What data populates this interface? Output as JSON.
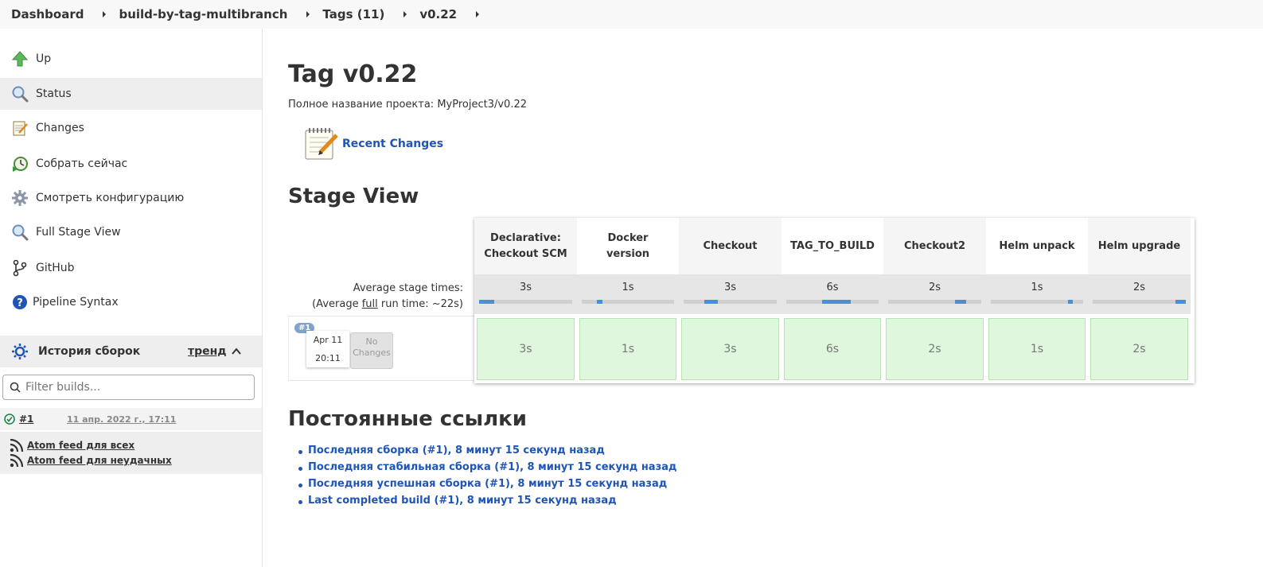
{
  "breadcrumb": [
    "Dashboard",
    "build-by-tag-multibranch",
    "Tags (11)",
    "v0.22"
  ],
  "sidebar": {
    "tasks": [
      {
        "label": "Up",
        "icon": "up-arrow-icon"
      },
      {
        "label": "Status",
        "icon": "magnifier-icon"
      },
      {
        "label": "Changes",
        "icon": "notepad-icon"
      },
      {
        "label": "Собрать сейчас",
        "icon": "build-clock-icon"
      },
      {
        "label": "Смотреть конфигурацию",
        "icon": "gear-icon"
      },
      {
        "label": "Full Stage View",
        "icon": "magnifier-icon"
      },
      {
        "label": "GitHub",
        "icon": "branch-icon"
      },
      {
        "label": "Pipeline Syntax",
        "icon": "help-icon"
      }
    ],
    "history": {
      "title": "История сборок",
      "trend": "тренд",
      "filter_placeholder": "Filter builds...",
      "builds": [
        {
          "number": "#1",
          "date": "11 апр. 2022 г., 17:11"
        }
      ],
      "feeds": [
        "Atom feed для всех",
        "Atom feed для неудачных"
      ]
    }
  },
  "main": {
    "title": "Tag v0.22",
    "full_name": "Полное название проекта: MyProject3/v0.22",
    "recent_changes": "Recent Changes",
    "stage_view_title": "Stage View",
    "avg_stage_times": "Average stage times:",
    "avg_full_prefix": "(Average ",
    "avg_full_word": "full",
    "avg_full_suffix": " run time: ~22s)",
    "stages": [
      {
        "name_line1": "Declarative:",
        "name_line2": "Checkout SCM",
        "avg": "3s",
        "run": "3s",
        "bar_start": 0.0,
        "bar_frac": 0.16
      },
      {
        "name_line1": "Docker",
        "name_line2": "version",
        "avg": "1s",
        "run": "1s",
        "bar_start": 0.16,
        "bar_frac": 0.06
      },
      {
        "name_line1": "Checkout",
        "name_line2": "",
        "avg": "3s",
        "run": "3s",
        "bar_start": 0.22,
        "bar_frac": 0.15
      },
      {
        "name_line1": "TAG_TO_BUILD",
        "name_line2": "",
        "avg": "6s",
        "run": "6s",
        "bar_start": 0.39,
        "bar_frac": 0.31
      },
      {
        "name_line1": "Checkout2",
        "name_line2": "",
        "avg": "2s",
        "run": "2s",
        "bar_start": 0.72,
        "bar_frac": 0.12
      },
      {
        "name_line1": "Helm unpack",
        "name_line2": "",
        "avg": "1s",
        "run": "1s",
        "bar_start": 0.84,
        "bar_frac": 0.05
      },
      {
        "name_line1": "Helm upgrade",
        "name_line2": "",
        "avg": "2s",
        "run": "2s",
        "bar_start": 0.89,
        "bar_frac": 0.11
      }
    ],
    "run": {
      "badge": "#1",
      "date": "Apr 11",
      "time": "20:11",
      "changes_line1": "No",
      "changes_line2": "Changes"
    },
    "permalinks_title": "Постоянные ссылки",
    "permalinks": [
      "Последняя сборка (#1), 8 минут 15 секунд назад",
      "Последняя стабильная сборка (#1), 8 минут 15 секунд назад",
      "Последняя успешная сборка (#1), 8 минут 15 секунд назад",
      "Last completed build (#1), 8 минут 15 секунд назад"
    ]
  },
  "colors": {
    "link": "#1f55b7",
    "stage_success": "#dff7dc",
    "bar_fill": "#4a90d9"
  }
}
